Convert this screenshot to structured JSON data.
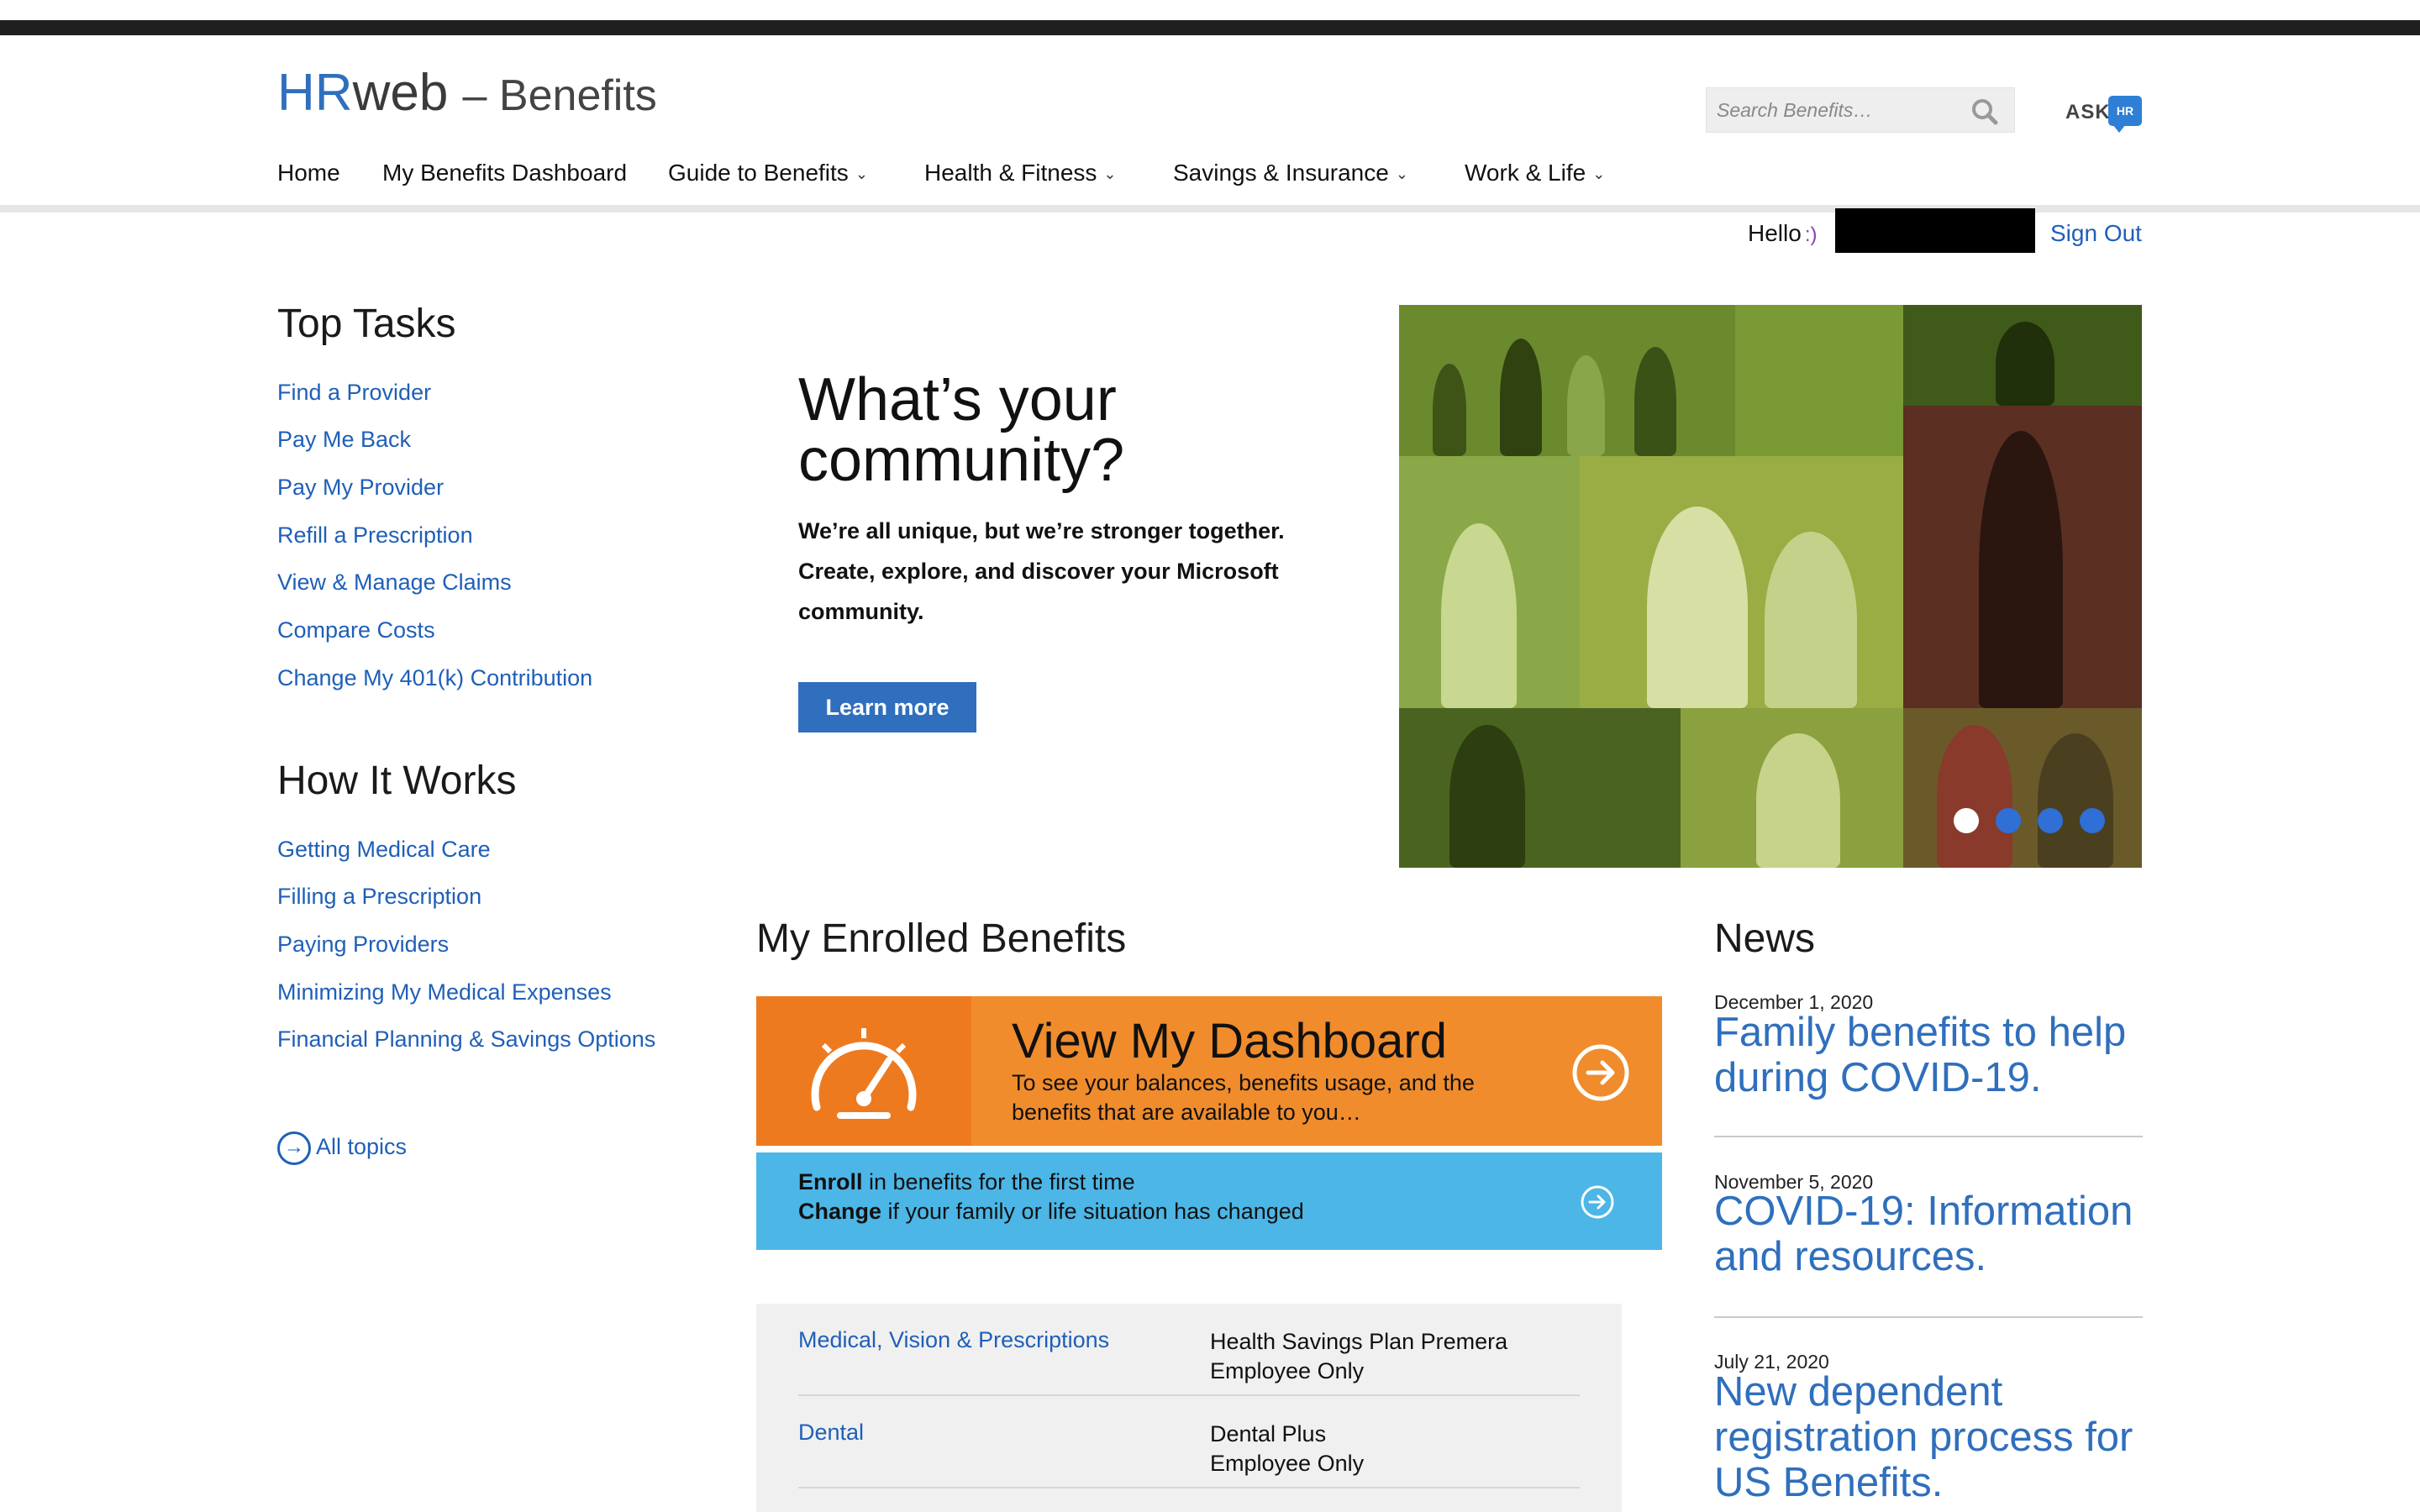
{
  "header": {
    "logo_hr": "HR",
    "logo_web": "web",
    "logo_suffix": "– Benefits",
    "search_placeholder": "Search Benefits…",
    "ask_label": "ASK",
    "ask_badge": "HR"
  },
  "nav": {
    "items": [
      {
        "label": "Home",
        "dropdown": false
      },
      {
        "label": "My Benefits Dashboard",
        "dropdown": false
      },
      {
        "label": "Guide to Benefits",
        "dropdown": true
      },
      {
        "label": "Health & Fitness",
        "dropdown": true
      },
      {
        "label": "Savings & Insurance",
        "dropdown": true
      },
      {
        "label": "Work & Life",
        "dropdown": true
      }
    ]
  },
  "user": {
    "greeting": "Hello",
    "smiley": ":)",
    "sign_out": "Sign Out"
  },
  "top_tasks": {
    "heading": "Top Tasks",
    "links": [
      "Find a Provider",
      "Pay Me Back",
      "Pay My Provider",
      "Refill a Prescription",
      "View & Manage Claims",
      "Compare Costs",
      "Change My 401(k) Contribution"
    ]
  },
  "how_it_works": {
    "heading": "How It Works",
    "links": [
      "Getting Medical Care",
      "Filling a Prescription",
      "Paying Providers",
      "Minimizing My Medical Expenses",
      "Financial Planning & Savings Options"
    ],
    "all_topics": "All topics"
  },
  "hero": {
    "title": "What’s your community?",
    "body": "We’re all unique, but we’re stronger together. Create, explore, and discover your Microsoft community.",
    "button": "Learn more",
    "slides": 4,
    "active_slide": 1
  },
  "enrolled": {
    "heading": "My Enrolled Benefits",
    "dashboard_title": "View My Dashboard",
    "dashboard_desc": "To see your balances, benefits usage, and the benefits that are available to you…",
    "enroll_bold": "Enroll",
    "enroll_rest": " in benefits for the first time",
    "change_bold": "Change",
    "change_rest": " if your family or life situation has changed",
    "rows": [
      {
        "label": "Medical, Vision & Prescriptions",
        "plan": "Health Savings Plan Premera",
        "coverage": "Employee Only"
      },
      {
        "label": "Dental",
        "plan": "Dental Plus",
        "coverage": "Employee Only"
      }
    ]
  },
  "news": {
    "heading": "News",
    "items": [
      {
        "date": "December 1, 2020",
        "headline": "Family benefits to help during COVID-19."
      },
      {
        "date": "November 5, 2020",
        "headline": "COVID-19: Information and resources."
      },
      {
        "date": "July 21, 2020",
        "headline": "New dependent registration process for US Benefits."
      }
    ]
  },
  "colors": {
    "brand_blue": "#2f6fbd",
    "link_blue": "#1f5fb8",
    "dashboard_orange": "#f08c2c",
    "enroll_blue": "#4cb6e6"
  }
}
